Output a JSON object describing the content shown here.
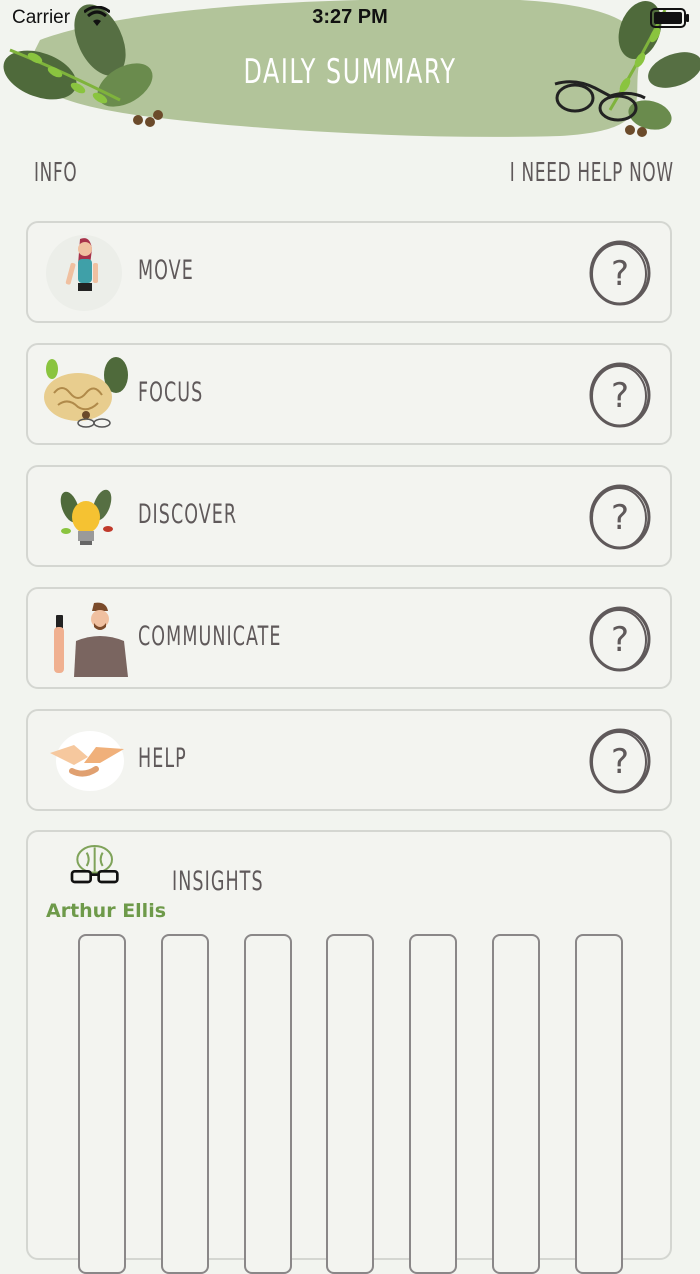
{
  "status_bar": {
    "carrier": "Carrier",
    "time": "3:27 PM"
  },
  "header": {
    "title": "DAILY SUMMARY"
  },
  "nav": {
    "info": "INFO",
    "help_now": "I NEED HELP NOW"
  },
  "cards": [
    {
      "label": "MOVE",
      "icon": "woman-figure-icon"
    },
    {
      "label": "FOCUS",
      "icon": "brain-icon"
    },
    {
      "label": "DISCOVER",
      "icon": "lightbulb-icon"
    },
    {
      "label": "COMMUNICATE",
      "icon": "man-with-phone-icon"
    },
    {
      "label": "HELP",
      "icon": "handshake-icon"
    }
  ],
  "insights": {
    "label": "INSIGHTS",
    "logo_text": "Arthur Ellis",
    "bar_count": 7
  },
  "colors": {
    "background": "#f2f4ef",
    "header_green": "#b2c49a",
    "leaf_dark": "#4f6a3b",
    "leaf_light": "#7fb33c",
    "text": "#5f595a",
    "card_border": "#d4d6d1",
    "logo_green": "#6e9a4a"
  }
}
